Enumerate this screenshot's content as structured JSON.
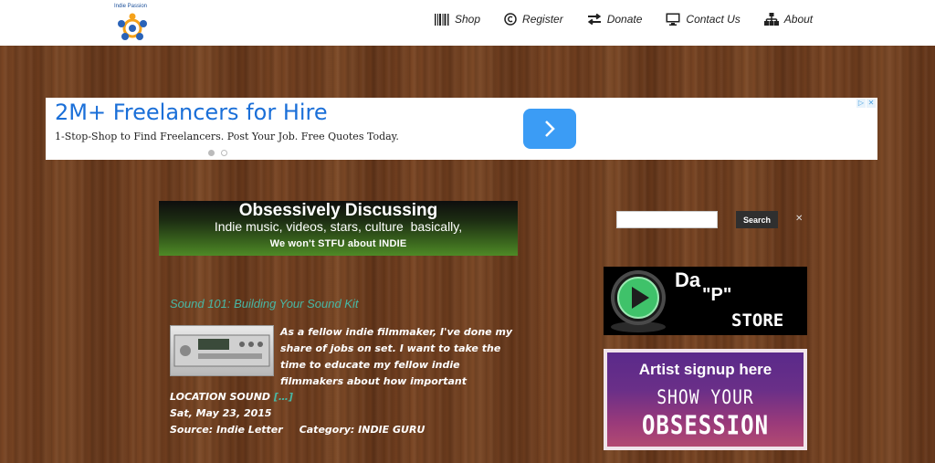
{
  "header": {
    "logo_text": "Indie Passion",
    "nav": [
      {
        "label": "Shop",
        "icon": "barcode-icon"
      },
      {
        "label": "Register",
        "icon": "copyright-icon"
      },
      {
        "label": "Donate",
        "icon": "exchange-arrows-icon"
      },
      {
        "label": "Contact Us",
        "icon": "monitor-icon"
      },
      {
        "label": "About",
        "icon": "sitemap-icon"
      }
    ]
  },
  "ad": {
    "title": "2M+ Freelancers for Hire",
    "subtitle": "1-Stop-Shop to Find Freelancers. Post Your Job. Free Quotes Today.",
    "button_icon": "chevron-right-icon",
    "corner": [
      "▷",
      "✕"
    ],
    "accent": "#1a6fd8",
    "button_color": "#3b9cf5"
  },
  "banner": {
    "title": "Obsessively Discussing",
    "line2": "Indie music, videos, stars, culture  basically,",
    "line3": "We won't STFU about INDIE"
  },
  "post": {
    "title": "Sound 101: Building Your Sound Kit",
    "excerpt": "As a fellow indie filmmaker, I've done my share of jobs on set. I want to take the time to educate my fellow indie filmmakers about how important",
    "excerpt_cont": "LOCATION SOUND ",
    "read_more": "[…]",
    "date": "Sat, May 23, 2015",
    "source": "Source: Indie Letter",
    "category": "Category: INDIE GURU",
    "link_color": "#48b7a4"
  },
  "sidebar": {
    "search_placeholder": "",
    "search_button": "Search",
    "search_close": "✕",
    "pstore": {
      "title": "Da",
      "p": "\"P\"",
      "store": "STORE"
    },
    "artist": {
      "line1": "Artist signup here",
      "line2": "SHOW  YOUR",
      "line3": "OBSESSION"
    }
  }
}
